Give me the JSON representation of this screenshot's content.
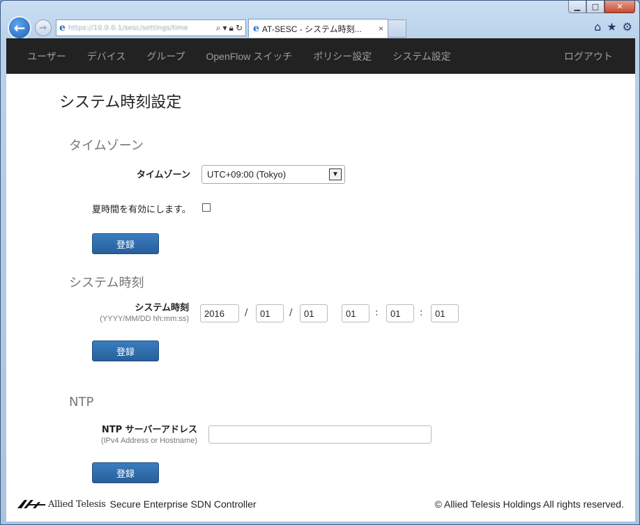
{
  "browser": {
    "url": "https://10.0.0.1/sesc/settings/time",
    "tab_title": "AT-SESC - システム時刻...",
    "tab_close": "×",
    "ie_glyph": "e"
  },
  "nav": {
    "items": [
      "ユーザー",
      "デバイス",
      "グループ",
      "OpenFlow スイッチ",
      "ポリシー設定",
      "システム設定"
    ],
    "logout": "ログアウト"
  },
  "page": {
    "title": "システム時刻設定"
  },
  "timezone_section": {
    "title": "タイムゾーン",
    "label": "タイムゾーン",
    "selected": "UTC+09:00 (Tokyo)",
    "dst_label": "夏時間を有効にします。",
    "dst_checked": false,
    "submit": "登録"
  },
  "systime_section": {
    "title": "システム時刻",
    "label": "システム時刻",
    "hint": "(YYYY/MM/DD hh:mm:ss)",
    "year": "2016",
    "month": "01",
    "day": "01",
    "hour": "01",
    "minute": "01",
    "second": "01",
    "date_sep": "/",
    "time_sep": ":",
    "submit": "登録"
  },
  "ntp_section": {
    "title": "NTP",
    "label": "NTP サーバーアドレス",
    "hint": "(IPv4 Address or Hostname)",
    "value": "",
    "submit": "登録"
  },
  "footer": {
    "logo_text": "Allied Telesis",
    "product": "Secure Enterprise SDN Controller",
    "copyright": "© Allied Telesis Holdings All rights reserved."
  }
}
